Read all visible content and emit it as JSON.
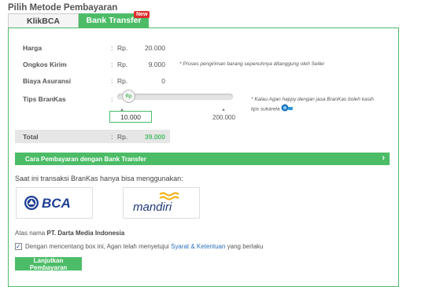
{
  "header": {
    "title": "Pilih Metode Pembayaran"
  },
  "tabs": [
    {
      "label": "KlikBCA",
      "active": false
    },
    {
      "label": "Bank Transfer",
      "active": true,
      "badge": "New"
    }
  ],
  "rows": {
    "harga": {
      "label": "Harga",
      "currency": "Rp.",
      "value": "20.000"
    },
    "ongkir": {
      "label": "Ongkos Kirim",
      "currency": "Rp.",
      "value": "9.000",
      "note": "* Proses pengiriman barang sepenuhnya ditanggung oleh Seller"
    },
    "asuransi": {
      "label": "Biaya Asuransi",
      "currency": "Rp.",
      "value": "0"
    },
    "tips": {
      "label": "Tips BranKas",
      "currency": "Rp.",
      "knob_label": "Rp",
      "note": "* Kalau Agan happy dengan jasa BranKas boleh kasih tips sukarela",
      "min_value": "10.000",
      "max_value": "200.000",
      "tick_min": "▲",
      "tick_max": "▲"
    },
    "total": {
      "label": "Total",
      "currency": "Rp.",
      "value": "39.000"
    }
  },
  "colon": ":",
  "guide_bar": {
    "label": "Cara Pembayaran dengan Bank Transfer",
    "chevron": "›"
  },
  "bank_info": {
    "text": "Saat ini transaksi BranKas hanya bisa menggunakan:",
    "banks": [
      {
        "name": "BCA",
        "logo_text": "BCA"
      },
      {
        "name": "mandiri",
        "logo_text": "mandiri"
      }
    ]
  },
  "account": {
    "prefix": "Atas nama",
    "name": "PT. Darta Media Indonesia"
  },
  "agreement": {
    "checked": true,
    "text_before": "Dengan mencentang box ini, Agan telah menyetujui",
    "link": "Syarat & Ketentuan",
    "text_after": "yang berlaku"
  },
  "submit": {
    "label": "Lanjutkan Pembayaran"
  },
  "colors": {
    "green": "#4cbc67",
    "red_badge": "#e02d2d",
    "bca_blue": "#1f3f94",
    "mandiri_navy": "#1e3a78",
    "mandiri_gold": "#f3b31b"
  }
}
